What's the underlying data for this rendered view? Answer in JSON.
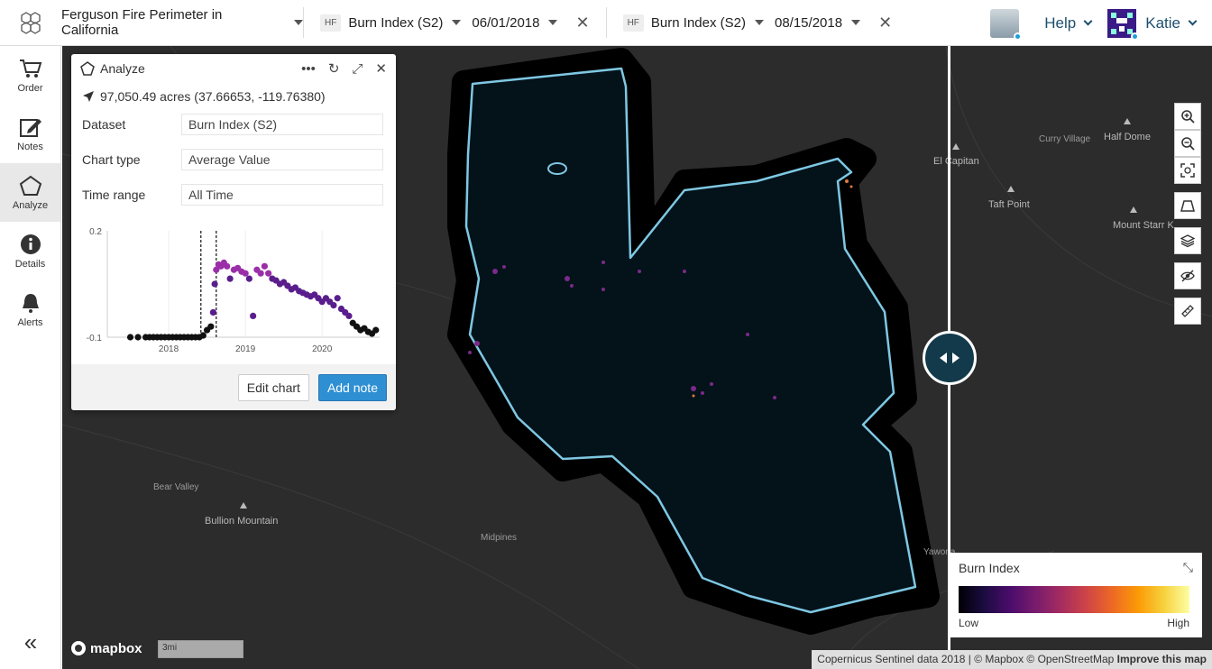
{
  "header": {
    "project": "Ferguson Fire Perimeter in California",
    "left_layer": {
      "badge": "HF",
      "name": "Burn Index (S2)",
      "date": "06/01/2018"
    },
    "right_layer": {
      "badge": "HF",
      "name": "Burn Index (S2)",
      "date": "08/15/2018"
    },
    "help": "Help",
    "user": "Katie"
  },
  "sidebar": {
    "items": [
      {
        "label": "Order",
        "icon": "cart-icon"
      },
      {
        "label": "Notes",
        "icon": "edit-icon"
      },
      {
        "label": "Analyze",
        "icon": "pentagon-icon",
        "active": true
      },
      {
        "label": "Details",
        "icon": "info-icon"
      },
      {
        "label": "Alerts",
        "icon": "bell-icon"
      }
    ],
    "collapse": "«"
  },
  "panel": {
    "title": "Analyze",
    "coords": "97,050.49 acres (37.66653, -119.76380)",
    "fields": [
      {
        "label": "Dataset",
        "value": "Burn Index (S2)"
      },
      {
        "label": "Chart type",
        "value": "Average Value"
      },
      {
        "label": "Time range",
        "value": "All Time"
      }
    ],
    "edit_label": "Edit chart",
    "add_label": "Add note"
  },
  "chart_data": {
    "type": "scatter",
    "xlabel": "",
    "ylabel": "",
    "ytick_labels": [
      "0.2",
      "-0.1"
    ],
    "xtick_labels": [
      "2018",
      "2019",
      "2020"
    ],
    "ylim": [
      -0.1,
      0.2
    ],
    "xlim": [
      2017.2,
      2020.75
    ],
    "markers": [
      2018.42,
      2018.62
    ],
    "series": [
      {
        "values": [
          [
            2017.5,
            -0.1
          ],
          [
            2017.6,
            -0.1
          ],
          [
            2017.7,
            -0.1
          ],
          [
            2017.75,
            -0.1
          ],
          [
            2017.8,
            -0.1
          ],
          [
            2017.85,
            -0.1
          ],
          [
            2017.9,
            -0.1
          ],
          [
            2017.95,
            -0.1
          ],
          [
            2018.0,
            -0.1
          ],
          [
            2018.05,
            -0.1
          ],
          [
            2018.1,
            -0.1
          ],
          [
            2018.15,
            -0.1
          ],
          [
            2018.2,
            -0.1
          ],
          [
            2018.25,
            -0.1
          ],
          [
            2018.3,
            -0.1
          ],
          [
            2018.35,
            -0.1
          ],
          [
            2018.4,
            -0.1
          ],
          [
            2018.45,
            -0.095
          ],
          [
            2018.5,
            -0.08
          ],
          [
            2018.55,
            -0.07
          ],
          [
            2018.58,
            -0.03
          ],
          [
            2018.6,
            0.05
          ],
          [
            2018.62,
            0.09
          ],
          [
            2018.65,
            0.105
          ],
          [
            2018.68,
            0.1
          ],
          [
            2018.72,
            0.11
          ],
          [
            2018.76,
            0.1
          ],
          [
            2018.8,
            0.065
          ],
          [
            2018.85,
            0.09
          ],
          [
            2018.9,
            0.095
          ],
          [
            2018.95,
            0.085
          ],
          [
            2019.0,
            0.08
          ],
          [
            2019.05,
            0.065
          ],
          [
            2019.1,
            -0.04
          ],
          [
            2019.15,
            0.09
          ],
          [
            2019.2,
            0.08
          ],
          [
            2019.25,
            0.1
          ],
          [
            2019.3,
            0.08
          ],
          [
            2019.35,
            0.065
          ],
          [
            2019.4,
            0.06
          ],
          [
            2019.45,
            0.05
          ],
          [
            2019.5,
            0.055
          ],
          [
            2019.55,
            0.045
          ],
          [
            2019.6,
            0.035
          ],
          [
            2019.65,
            0.04
          ],
          [
            2019.7,
            0.03
          ],
          [
            2019.75,
            0.025
          ],
          [
            2019.8,
            0.02
          ],
          [
            2019.85,
            0.015
          ],
          [
            2019.9,
            0.02
          ],
          [
            2019.95,
            0.01
          ],
          [
            2020.0,
            0.0
          ],
          [
            2020.05,
            0.01
          ],
          [
            2020.1,
            0.0
          ],
          [
            2020.15,
            -0.01
          ],
          [
            2020.2,
            0.01
          ],
          [
            2020.25,
            -0.02
          ],
          [
            2020.3,
            -0.03
          ],
          [
            2020.35,
            -0.04
          ],
          [
            2020.4,
            -0.06
          ],
          [
            2020.45,
            -0.07
          ],
          [
            2020.5,
            -0.08
          ],
          [
            2020.55,
            -0.075
          ],
          [
            2020.6,
            -0.085
          ],
          [
            2020.65,
            -0.09
          ],
          [
            2020.7,
            -0.08
          ]
        ]
      }
    ]
  },
  "map": {
    "labels": [
      {
        "text": "El Capitan",
        "cls": "big"
      },
      {
        "text": "Curry Village",
        "cls": ""
      },
      {
        "text": "Half Dome",
        "cls": "big"
      },
      {
        "text": "Taft Point",
        "cls": "big"
      },
      {
        "text": "Mount Starr K",
        "cls": "big"
      },
      {
        "text": "Bear Valley",
        "cls": ""
      },
      {
        "text": "Bullion Mountain",
        "cls": "big"
      },
      {
        "text": "Midpines",
        "cls": ""
      },
      {
        "text": "Yawona",
        "cls": ""
      }
    ],
    "scale": "3mi",
    "mapbox": "mapbox"
  },
  "legend": {
    "title": "Burn Index",
    "low": "Low",
    "high": "High"
  },
  "attribution": {
    "text": "Copernicus Sentinel data 2018 | © Mapbox © OpenStreetMap",
    "link": "Improve this map"
  },
  "colors": {
    "accent": "#2e8fd3",
    "perimeter": "#7ec8e3",
    "handle": "#123a4a"
  }
}
